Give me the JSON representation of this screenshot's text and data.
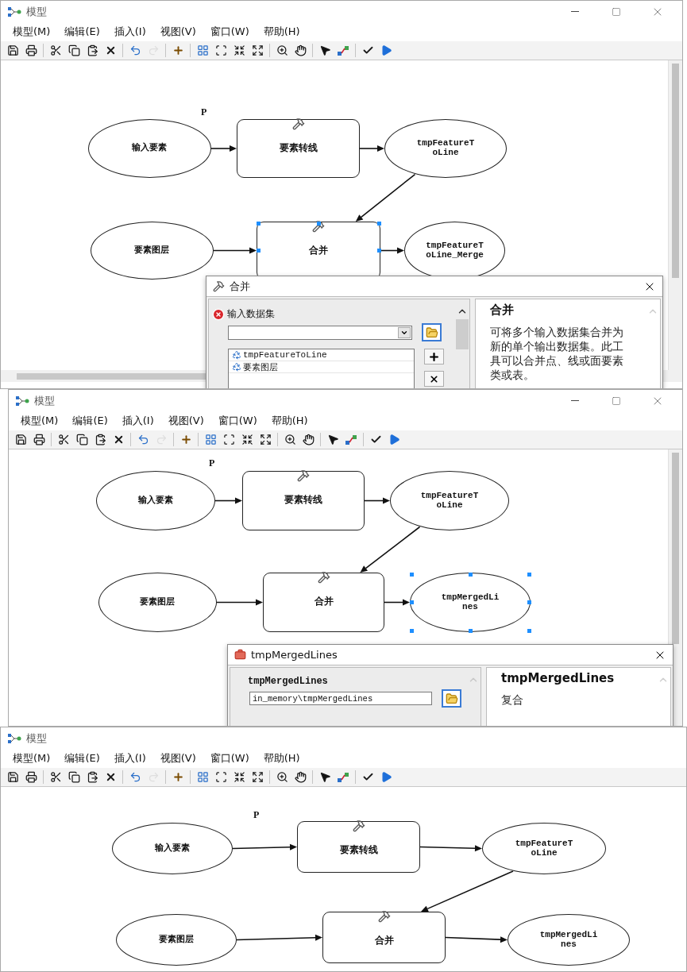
{
  "windows": [
    {
      "title": "模型",
      "buttons_visible": true,
      "menus": [
        "模型(M)",
        "编辑(E)",
        "插入(I)",
        "视图(V)",
        "窗口(W)",
        "帮助(H)"
      ],
      "toolbar": [
        {
          "kind": "save",
          "disabled": false
        },
        {
          "kind": "print",
          "disabled": false
        },
        {
          "kind": "separator"
        },
        {
          "kind": "cut",
          "disabled": false
        },
        {
          "kind": "copy",
          "disabled": false
        },
        {
          "kind": "paste",
          "disabled": false
        },
        {
          "kind": "delete",
          "disabled": false
        },
        {
          "kind": "separator"
        },
        {
          "kind": "undo",
          "disabled": false
        },
        {
          "kind": "redo",
          "disabled": true
        },
        {
          "kind": "separator"
        },
        {
          "kind": "add_data",
          "disabled": false
        },
        {
          "kind": "separator"
        },
        {
          "kind": "auto_layout",
          "disabled": false
        },
        {
          "kind": "full_extent",
          "disabled": false
        },
        {
          "kind": "zoom_in_fixed",
          "disabled": false
        },
        {
          "kind": "zoom_out_fixed",
          "disabled": false
        },
        {
          "kind": "separator"
        },
        {
          "kind": "zoom",
          "disabled": false
        },
        {
          "kind": "pan",
          "disabled": false
        },
        {
          "kind": "separator"
        },
        {
          "kind": "select",
          "disabled": false
        },
        {
          "kind": "connect",
          "disabled": false
        },
        {
          "kind": "separator"
        },
        {
          "kind": "validate",
          "disabled": false
        },
        {
          "kind": "run",
          "disabled": false
        }
      ],
      "nodes": [
        {
          "kind": "data",
          "label": "输入要素",
          "selected": false
        },
        {
          "kind": "tool",
          "label": "要素转线",
          "badge": "P",
          "selected": false
        },
        {
          "kind": "data",
          "label": "tmpFeatureToLine",
          "selected": false
        },
        {
          "kind": "data",
          "label": "要素图层",
          "selected": false
        },
        {
          "kind": "tool",
          "label": "合并",
          "selected": true
        },
        {
          "kind": "data",
          "label": "tmpFeatureToLine_Merge",
          "selected": false
        }
      ],
      "dialog": {
        "kind": "tool",
        "title": "合并",
        "param_label": "输入数据集",
        "error": true,
        "list_items": [
          "tmpFeatureToLine",
          "要素图层"
        ],
        "help_title": "合并",
        "help_text": "可将多个输入数据集合并为新的单个输出数据集。此工具可以合并点、线或面要素类或表。"
      }
    },
    {
      "title": "模型",
      "buttons_visible": true,
      "menus": [
        "模型(M)",
        "编辑(E)",
        "插入(I)",
        "视图(V)",
        "窗口(W)",
        "帮助(H)"
      ],
      "toolbar": [
        {
          "kind": "save",
          "disabled": false
        },
        {
          "kind": "print",
          "disabled": false
        },
        {
          "kind": "separator"
        },
        {
          "kind": "cut",
          "disabled": false
        },
        {
          "kind": "copy",
          "disabled": false
        },
        {
          "kind": "paste",
          "disabled": false
        },
        {
          "kind": "delete",
          "disabled": false
        },
        {
          "kind": "separator"
        },
        {
          "kind": "undo",
          "disabled": false
        },
        {
          "kind": "redo",
          "disabled": true
        },
        {
          "kind": "separator"
        },
        {
          "kind": "add_data",
          "disabled": false
        },
        {
          "kind": "separator"
        },
        {
          "kind": "auto_layout",
          "disabled": false
        },
        {
          "kind": "full_extent",
          "disabled": false
        },
        {
          "kind": "zoom_in_fixed",
          "disabled": false
        },
        {
          "kind": "zoom_out_fixed",
          "disabled": false
        },
        {
          "kind": "separator"
        },
        {
          "kind": "zoom",
          "disabled": false
        },
        {
          "kind": "pan",
          "disabled": false
        },
        {
          "kind": "separator"
        },
        {
          "kind": "select",
          "disabled": false
        },
        {
          "kind": "connect",
          "disabled": false
        },
        {
          "kind": "separator"
        },
        {
          "kind": "validate",
          "disabled": false
        },
        {
          "kind": "run",
          "disabled": false
        }
      ],
      "nodes": [
        {
          "kind": "data",
          "label": "输入要素",
          "selected": false
        },
        {
          "kind": "tool",
          "label": "要素转线",
          "badge": "P",
          "selected": false
        },
        {
          "kind": "data",
          "label": "tmpFeatureToLine",
          "selected": false
        },
        {
          "kind": "data",
          "label": "要素图层",
          "selected": false
        },
        {
          "kind": "tool",
          "label": "合并",
          "selected": false
        },
        {
          "kind": "data",
          "label": "tmpMergedLines",
          "selected": true
        }
      ],
      "dialog": {
        "kind": "variable",
        "title": "tmpMergedLines",
        "param_label": "tmpMergedLines",
        "value": "in_memory\\tmpMergedLines",
        "help_title": "tmpMergedLines",
        "help_text": "复合"
      }
    },
    {
      "title": "模型",
      "buttons_visible": false,
      "menus": [
        "模型(M)",
        "编辑(E)",
        "插入(I)",
        "视图(V)",
        "窗口(W)",
        "帮助(H)"
      ],
      "toolbar": [
        {
          "kind": "save",
          "disabled": false
        },
        {
          "kind": "print",
          "disabled": false
        },
        {
          "kind": "separator"
        },
        {
          "kind": "cut",
          "disabled": false
        },
        {
          "kind": "copy",
          "disabled": false
        },
        {
          "kind": "paste",
          "disabled": false
        },
        {
          "kind": "delete",
          "disabled": false
        },
        {
          "kind": "separator"
        },
        {
          "kind": "undo",
          "disabled": false
        },
        {
          "kind": "redo",
          "disabled": true
        },
        {
          "kind": "separator"
        },
        {
          "kind": "add_data",
          "disabled": false
        },
        {
          "kind": "separator"
        },
        {
          "kind": "auto_layout",
          "disabled": false
        },
        {
          "kind": "full_extent",
          "disabled": false
        },
        {
          "kind": "zoom_in_fixed",
          "disabled": false
        },
        {
          "kind": "zoom_out_fixed",
          "disabled": false
        },
        {
          "kind": "separator"
        },
        {
          "kind": "zoom",
          "disabled": false
        },
        {
          "kind": "pan",
          "disabled": false
        },
        {
          "kind": "separator"
        },
        {
          "kind": "select",
          "disabled": false
        },
        {
          "kind": "connect",
          "disabled": false
        },
        {
          "kind": "separator"
        },
        {
          "kind": "validate",
          "disabled": false
        },
        {
          "kind": "run",
          "disabled": false
        }
      ],
      "nodes": [
        {
          "kind": "data",
          "label": "输入要素",
          "selected": false
        },
        {
          "kind": "tool",
          "label": "要素转线",
          "badge": "P",
          "selected": false
        },
        {
          "kind": "data",
          "label": "tmpFeatureToLine",
          "selected": false
        },
        {
          "kind": "data",
          "label": "要素图层",
          "selected": false
        },
        {
          "kind": "tool",
          "label": "合并",
          "selected": false
        },
        {
          "kind": "data",
          "label": "tmpMergedLines",
          "selected": false
        }
      ]
    }
  ]
}
